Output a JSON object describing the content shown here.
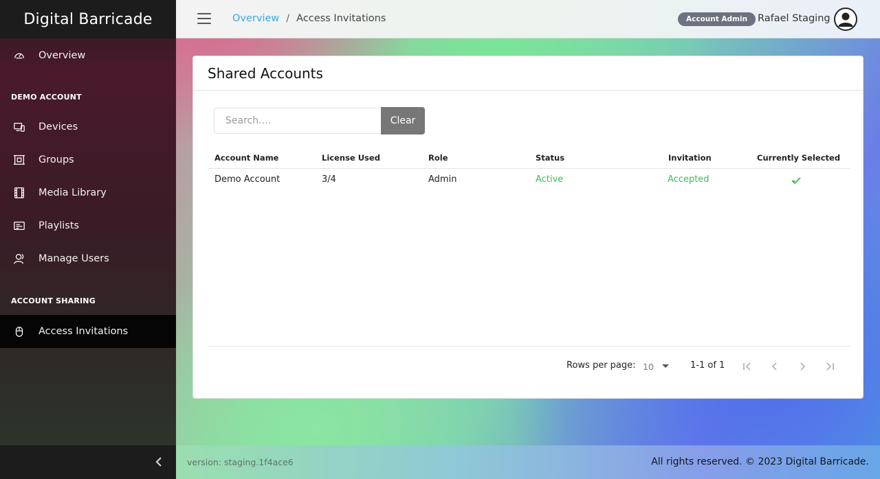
{
  "brand": {
    "name": "Digital Barricade"
  },
  "sidebar": {
    "overview_label": "Overview",
    "section_demo": "DEMO ACCOUNT",
    "section_sharing": "ACCOUNT SHARING",
    "items": [
      {
        "label": "Devices",
        "icon": "devices-icon"
      },
      {
        "label": "Groups",
        "icon": "groups-icon"
      },
      {
        "label": "Media Library",
        "icon": "film-icon"
      },
      {
        "label": "Playlists",
        "icon": "playlist-icon"
      },
      {
        "label": "Manage Users",
        "icon": "users-icon"
      }
    ],
    "active_item": {
      "label": "Access Invitations",
      "icon": "mouse-icon"
    }
  },
  "topbar": {
    "breadcrumb": {
      "root": "Overview",
      "separator": "/",
      "current": "Access Invitations"
    },
    "role_badge": "Account Admin",
    "user_name": "Rafael Staging"
  },
  "card": {
    "title": "Shared Accounts",
    "search": {
      "placeholder": "Search....",
      "value": ""
    },
    "clear_label": "Clear",
    "columns": [
      "Account Name",
      "License Used",
      "Role",
      "Status",
      "Invitation",
      "Currently Selected"
    ],
    "rows": [
      {
        "account_name": "Demo Account",
        "license_used": "3/4",
        "role": "Admin",
        "status": "Active",
        "invitation": "Accepted",
        "currently_selected": "check-icon"
      }
    ],
    "pagination": {
      "rows_per_page_label": "Rows per page:",
      "rows_per_page_value": "10",
      "range": "1-1 of 1"
    }
  },
  "footer": {
    "version": "version: staging.1f4ace6",
    "rights": "All rights reserved. © 2023 Digital Barricade."
  },
  "colors": {
    "accent_link": "#3aa7e0",
    "status_green": "#3dbb54",
    "active_nav_bg": "#050505",
    "badge_bg": "#6b7280"
  }
}
